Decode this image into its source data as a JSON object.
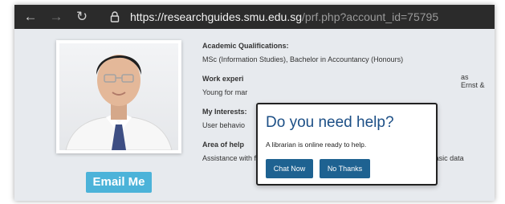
{
  "browser": {
    "nav": {
      "back_icon": "←",
      "forward_icon": "→",
      "reload_icon": "↻"
    },
    "url_domain": "https://researchguides.smu.edu.sg",
    "url_path": "/prf.php?account_id=75795"
  },
  "profile": {
    "email_button": "Email Me",
    "sections": [
      {
        "label": "Academic Qualifications:",
        "text": "MSc (Information Studies), Bachelor in Accountancy (Honours)"
      },
      {
        "label": "Work experi",
        "text": "Young for mar"
      },
      {
        "label": "My Interests:",
        "text": "User behavio"
      },
      {
        "label": "Area of help",
        "text": "Assistance with finding accounting/finance datasets. Provide training in basic data"
      }
    ],
    "work_text_right": "as Ernst &"
  },
  "modal": {
    "title": "Do you need help?",
    "message": "A librarian is online ready to help.",
    "chat_button": "Chat Now",
    "decline_button": "No Thanks"
  }
}
